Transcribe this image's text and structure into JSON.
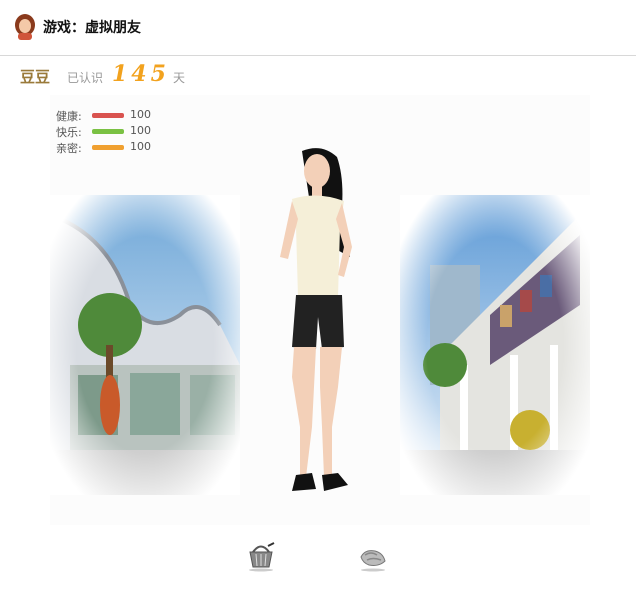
{
  "header": {
    "title": "游戏：虚拟朋友",
    "avatar_icon": "girl-avatar-icon"
  },
  "friend": {
    "name": "豆豆",
    "known_label": "已认识",
    "days": "145",
    "day_unit": "天"
  },
  "stats": [
    {
      "label": "健康:",
      "value": "100",
      "color": "#d9534f"
    },
    {
      "label": "快乐:",
      "value": "100",
      "color": "#7ac143"
    },
    {
      "label": "亲密:",
      "value": "100",
      "color": "#f0a030"
    }
  ],
  "tools": [
    {
      "name": "shopping-basket-icon"
    },
    {
      "name": "hand-interact-icon"
    }
  ]
}
